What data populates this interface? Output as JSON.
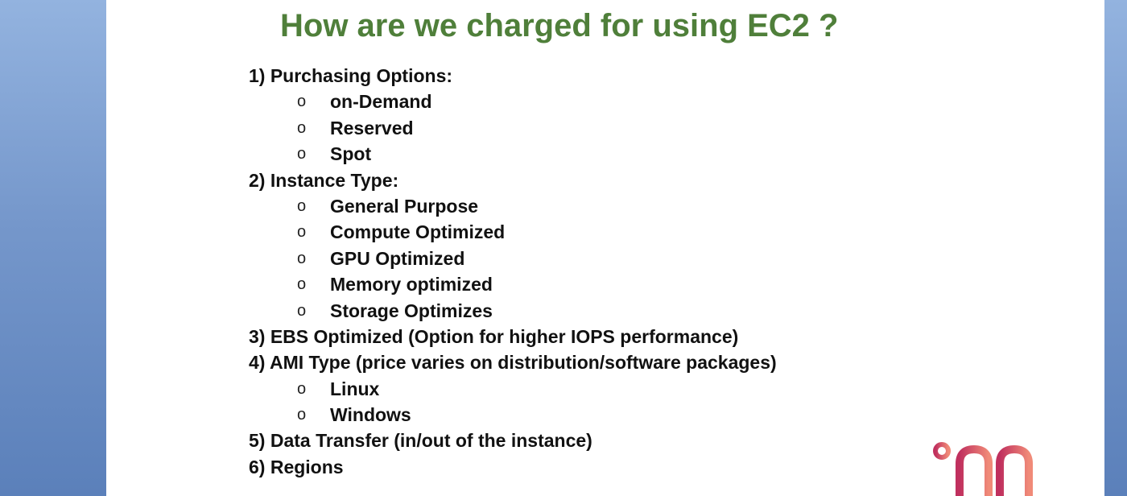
{
  "slide": {
    "title": "How are we charged for using EC2 ?",
    "bullet_glyph": "o",
    "items": [
      {
        "level": 1,
        "text": "1) Purchasing Options:"
      },
      {
        "level": 2,
        "text": "on-Demand"
      },
      {
        "level": 2,
        "text": "Reserved"
      },
      {
        "level": 2,
        "text": "Spot"
      },
      {
        "level": 1,
        "text": "2) Instance Type:"
      },
      {
        "level": 2,
        "text": "General Purpose"
      },
      {
        "level": 2,
        "text": "Compute Optimized"
      },
      {
        "level": 2,
        "text": "GPU Optimized"
      },
      {
        "level": 2,
        "text": "Memory optimized"
      },
      {
        "level": 2,
        "text": "Storage Optimizes"
      },
      {
        "level": 1,
        "text": "3) EBS Optimized (Option for higher IOPS performance)"
      },
      {
        "level": 1,
        "text": "4) AMI Type (price varies on distribution/software packages)"
      },
      {
        "level": 2,
        "text": "Linux"
      },
      {
        "level": 2,
        "text": "Windows"
      },
      {
        "level": 1,
        "text": "5) Data Transfer (in/out of the instance)"
      },
      {
        "level": 1,
        "text": "6) Regions"
      }
    ]
  },
  "colors": {
    "title": "#4f7f3a",
    "text": "#111111",
    "background": "#ffffff",
    "frame": "#7597cb",
    "logo_start": "#c0305e",
    "logo_end": "#f08a78"
  },
  "logo": {
    "icon": "brand-logo-icon"
  }
}
